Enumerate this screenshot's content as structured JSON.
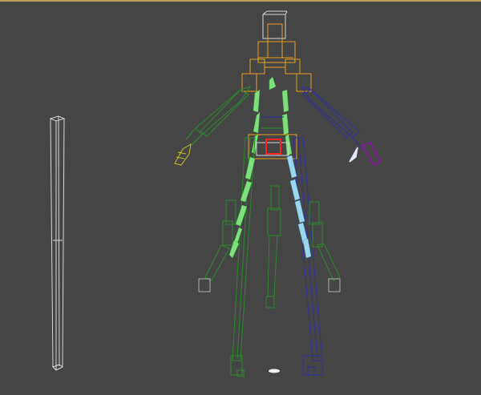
{
  "viewport": {
    "active_border_color": "#c8a850",
    "background_color": "#454545"
  },
  "scene": {
    "colors": {
      "helper_box": "#d8d8d8",
      "head_bones": "#e8a020",
      "left_arm": "#2a8a2a",
      "right_arm": "#3030a0",
      "left_leg": "#2a8a2a",
      "right_leg": "#3030a0",
      "spine_markers": "#7de07d",
      "pelvis_selection": "#ff2020",
      "hand_right_accent": "#9010b0",
      "hand_left_accent": "#c8c020",
      "ground_marker": "#f0f0f0"
    },
    "objects": [
      "tall-box-helper",
      "biped-head",
      "biped-left-arm",
      "biped-right-arm",
      "biped-pelvis",
      "biped-left-leg",
      "biped-right-leg",
      "biped-center-tail",
      "ground-marker"
    ]
  }
}
